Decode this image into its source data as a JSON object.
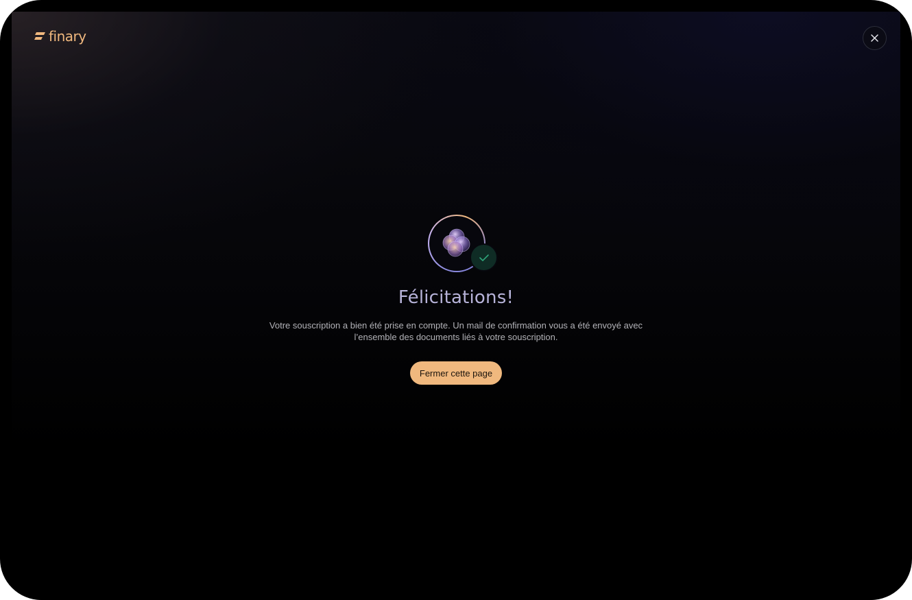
{
  "brand": {
    "logo_text": "finary",
    "accent_color": "#f0b87e"
  },
  "header": {
    "close_icon": "close-icon"
  },
  "success": {
    "illustration_icon": "overlapping-circles-icon",
    "status_icon": "checkmark-icon",
    "title": "Félicitations!",
    "message_line1": "Votre souscription a bien été prise en compte. Un mail de confirmation vous a été envoyé avec",
    "message_line2": "l’ensemble des documents liés à votre souscription.",
    "button_label": "Fermer cette page"
  },
  "colors": {
    "background": "#000000",
    "title": "#b7b3d9",
    "text": "#b3b3b8",
    "check_badge_bg": "#0f2c25",
    "check_mark": "#2fa57a"
  }
}
